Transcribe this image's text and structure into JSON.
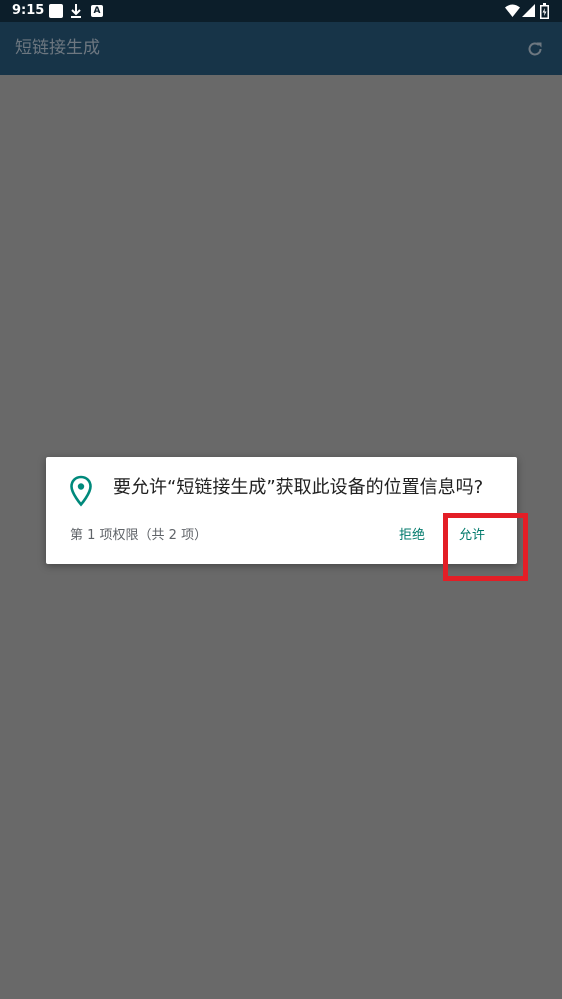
{
  "status_bar": {
    "time": "9:15",
    "a_icon_label": "A",
    "icons": [
      "square-notification-icon",
      "download-icon",
      "a-icon",
      "wifi-icon",
      "signal-icon",
      "battery-icon"
    ]
  },
  "app_bar": {
    "title": "短链接生成",
    "action_icon": "refresh-icon"
  },
  "permission_dialog": {
    "icon": "location-pin-icon",
    "message": "要允许“短链接生成”获取此设备的位置信息吗?",
    "counter": "第 1 项权限（共 2 项）",
    "deny_label": "拒绝",
    "allow_label": "允许"
  },
  "colors": {
    "scrim": "#696969",
    "status_bar": "#0c1e2a",
    "app_bar": "#173448",
    "accent": "#00897b",
    "highlight": "#e31e26"
  }
}
